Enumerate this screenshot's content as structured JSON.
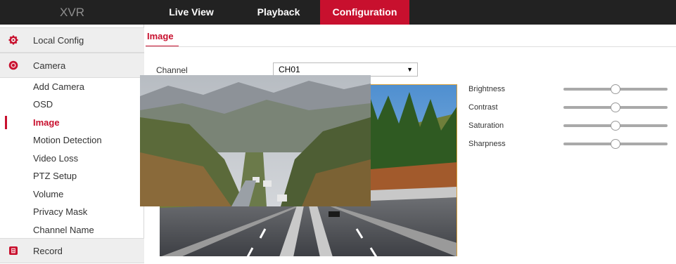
{
  "header": {
    "brand": "XVR",
    "tabs": [
      {
        "label": "Live View",
        "active": false
      },
      {
        "label": "Playback",
        "active": false
      },
      {
        "label": "Configuration",
        "active": true
      }
    ]
  },
  "sidebar": {
    "groups": [
      {
        "label": "Local Config",
        "icon": "gear-icon"
      },
      {
        "label": "Camera",
        "icon": "camera-lens-icon"
      },
      {
        "label": "Record",
        "icon": "record-icon"
      }
    ],
    "camera_items": [
      {
        "label": "Add Camera"
      },
      {
        "label": "OSD"
      },
      {
        "label": "Image",
        "active": true
      },
      {
        "label": "Motion Detection"
      },
      {
        "label": "Video Loss"
      },
      {
        "label": "PTZ Setup"
      },
      {
        "label": "Volume"
      },
      {
        "label": "Privacy Mask"
      },
      {
        "label": "Channel Name"
      }
    ]
  },
  "main": {
    "title": "Image",
    "channel_label": "Channel",
    "channel_value": "CH01",
    "adjustments": [
      {
        "label": "Brightness",
        "level": 0.5
      },
      {
        "label": "Contrast",
        "level": 0.5
      },
      {
        "label": "Saturation",
        "level": 0.5
      },
      {
        "label": "Sharpness",
        "level": 0.5
      }
    ]
  },
  "colors": {
    "accent": "#c8102e",
    "topbar": "#222222"
  }
}
